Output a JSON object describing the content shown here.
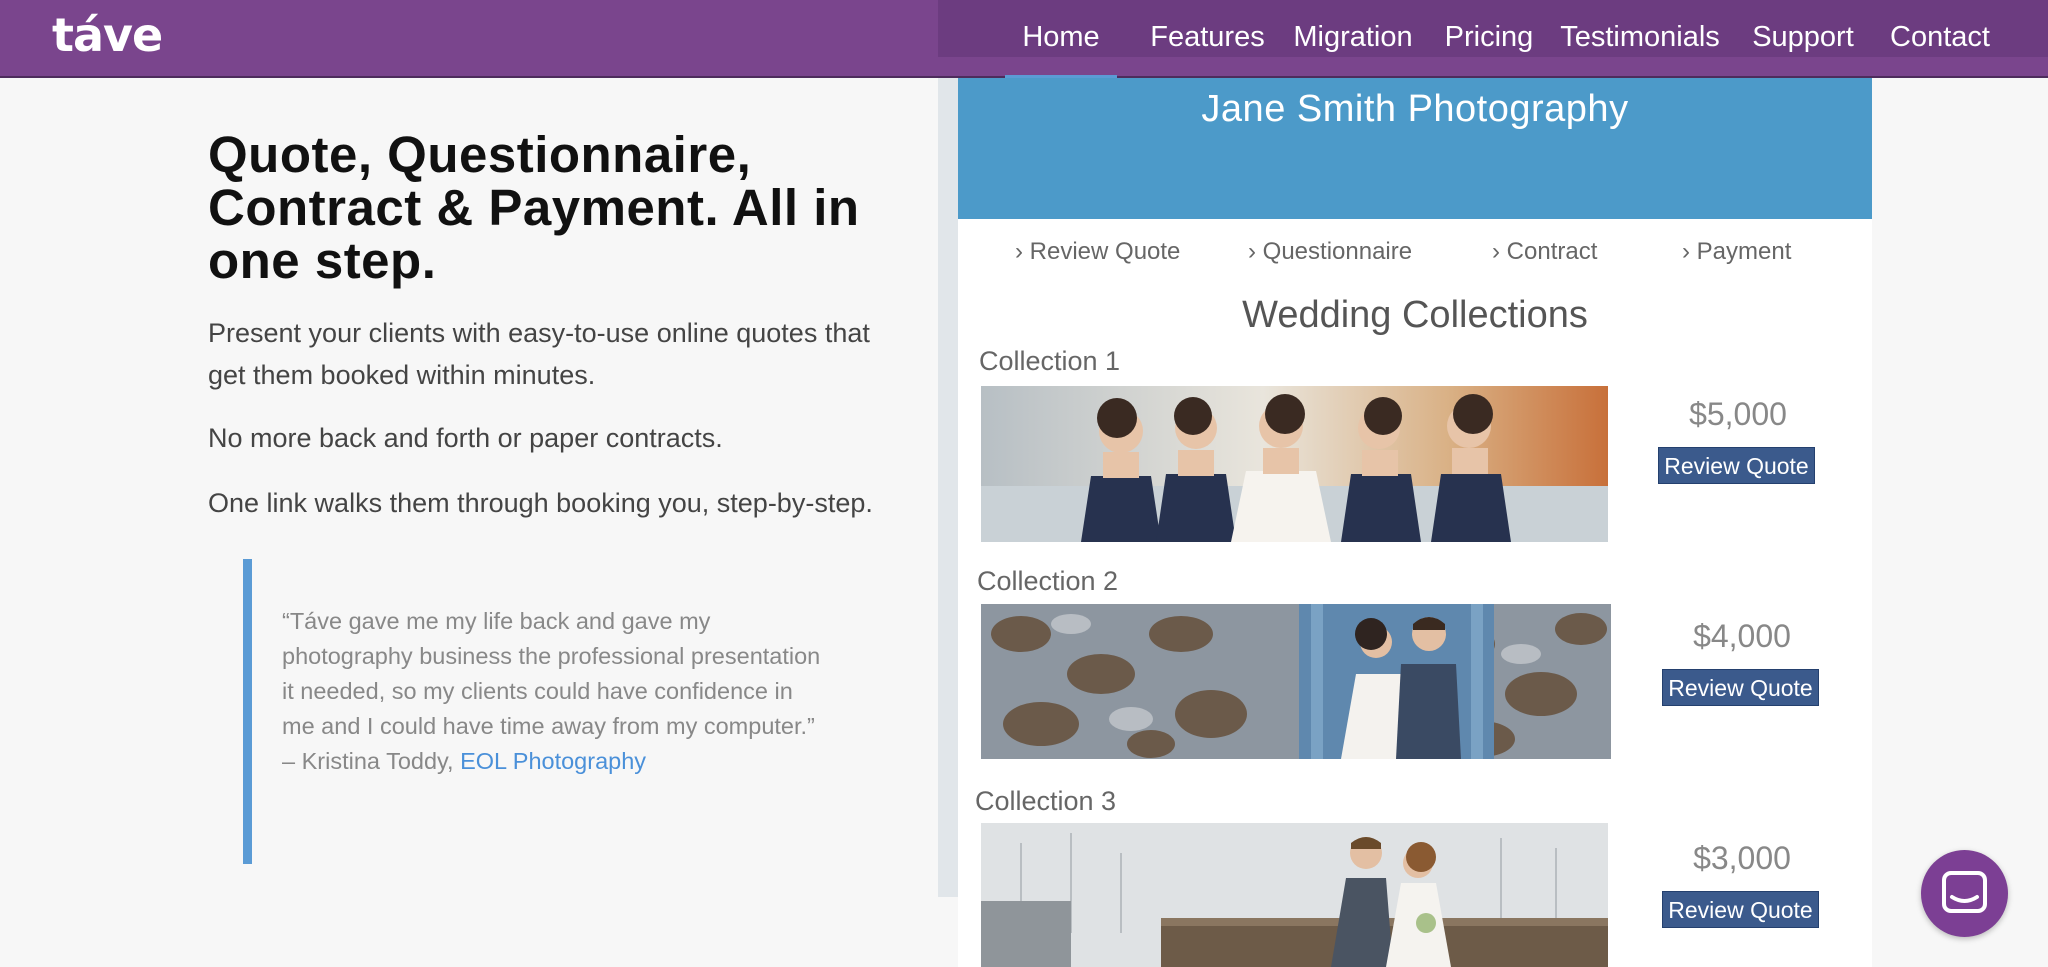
{
  "header": {
    "logo": "táve",
    "nav": [
      "Home",
      "Features",
      "Migration",
      "Pricing",
      "Testimonials",
      "Support",
      "Contact"
    ],
    "active": "Home",
    "colors": {
      "bar": "#7a458d",
      "accent": "#5b9bd5"
    }
  },
  "hero": {
    "headline": "Quote, Questionnaire, Contract & Payment. All in one step.",
    "paragraphs": [
      "Present your clients with easy-to-use online quotes that get them booked within minutes.",
      "No more back and forth or paper contracts.",
      "One link walks them through booking you, step-by-step."
    ],
    "quote": {
      "text": "“Táve gave me my life back and gave my photography business the professional presentation it needed, so my clients could have confidence in me and I could have time away from my computer.” – Kristina Toddy, ",
      "link": "EOL Photography"
    }
  },
  "mockup": {
    "studio": "Jane Smith Photography",
    "steps": [
      "› Review Quote",
      "› Questionnaire",
      "› Contract",
      "› Payment"
    ],
    "heading": "Wedding Collections",
    "collections": [
      {
        "label": "Collection 1",
        "price": "$5,000",
        "button": "Review Quote",
        "photo": "bride-with-bridesmaids-photo"
      },
      {
        "label": "Collection 2",
        "price": "$4,000",
        "button": "Review Quote",
        "photo": "couple-stone-wall-photo"
      },
      {
        "label": "Collection 3",
        "price": "$3,000",
        "button": "Review Quote",
        "photo": "couple-marina-photo"
      }
    ]
  },
  "chat": {
    "icon": "chat-icon"
  }
}
